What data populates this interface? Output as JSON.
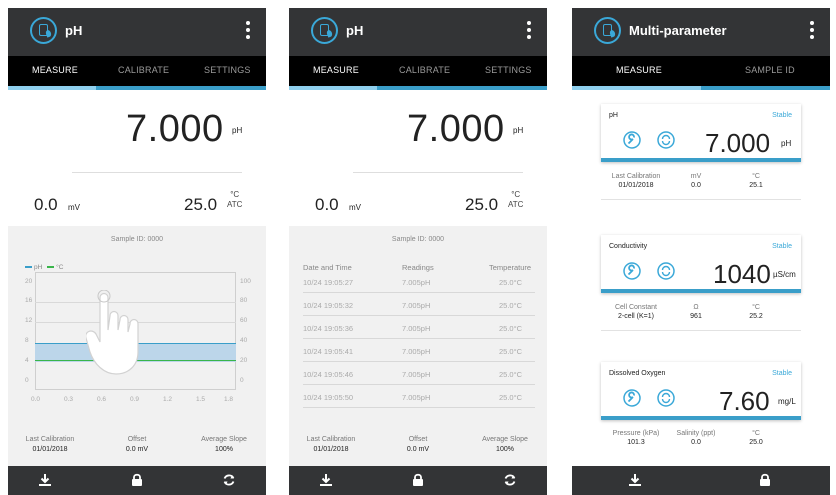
{
  "screens": [
    {
      "app_title": "pH",
      "tabs": [
        "MEASURE",
        "CALIBRATE",
        "SETTINGS"
      ],
      "main_value": "7.000",
      "main_unit": "pH",
      "mv_value": "0.0",
      "mv_unit": "mV",
      "temp_value": "25.0",
      "temp_unit_top": "°C",
      "temp_unit_bottom": "ATC",
      "sample_id": "Sample ID: 0000",
      "legend": [
        "pH",
        "°C"
      ],
      "left_ticks": [
        "20",
        "16",
        "12",
        "8",
        "4",
        "0"
      ],
      "right_ticks": [
        "100",
        "80",
        "60",
        "40",
        "20",
        "0"
      ],
      "x_ticks": [
        "0.0",
        "0.3",
        "0.6",
        "0.9",
        "1.2",
        "1.5",
        "1.8"
      ],
      "footer": [
        {
          "label": "Last Calibration",
          "value": "01/01/2018"
        },
        {
          "label": "Offset",
          "value": "0.0 mV"
        },
        {
          "label": "Average Slope",
          "value": "100%"
        }
      ]
    },
    {
      "app_title": "pH",
      "tabs": [
        "MEASURE",
        "CALIBRATE",
        "SETTINGS"
      ],
      "main_value": "7.000",
      "main_unit": "pH",
      "mv_value": "0.0",
      "mv_unit": "mV",
      "temp_value": "25.0",
      "temp_unit_top": "°C",
      "temp_unit_bottom": "ATC",
      "sample_id": "Sample ID: 0000",
      "table_headers": [
        "Date and Time",
        "Readings",
        "Temperature"
      ],
      "table_rows": [
        [
          "10/24 19:05:27",
          "7.005pH",
          "25.0°C"
        ],
        [
          "10/24 19:05:32",
          "7.005pH",
          "25.0°C"
        ],
        [
          "10/24 19:05:36",
          "7.005pH",
          "25.0°C"
        ],
        [
          "10/24 19:05:41",
          "7.005pH",
          "25.0°C"
        ],
        [
          "10/24 19:05:46",
          "7.005pH",
          "25.0°C"
        ],
        [
          "10/24 19:05:50",
          "7.005pH",
          "25.0°C"
        ]
      ],
      "footer": [
        {
          "label": "Last Calibration",
          "value": "01/01/2018"
        },
        {
          "label": "Offset",
          "value": "0.0 mV"
        },
        {
          "label": "Average Slope",
          "value": "100%"
        }
      ]
    },
    {
      "app_title": "Multi-parameter",
      "tabs": [
        "MEASURE",
        "SAMPLE ID"
      ],
      "cards": [
        {
          "title": "pH",
          "status": "Stable",
          "value": "7.000",
          "unit": "pH",
          "sub": [
            {
              "label": "Last Calibration",
              "value": "01/01/2018"
            },
            {
              "label": "mV",
              "value": "0.0"
            },
            {
              "label": "°C",
              "value": "25.1"
            }
          ]
        },
        {
          "title": "Conductivity",
          "status": "Stable",
          "value": "1040",
          "unit": "µS/cm",
          "sub": [
            {
              "label": "Cell Constant",
              "value": "2-cell (K=1)"
            },
            {
              "label": "Ω",
              "value": "961"
            },
            {
              "label": "°C",
              "value": "25.2"
            }
          ]
        },
        {
          "title": "Dissolved Oxygen",
          "status": "Stable",
          "value": "7.60",
          "unit": "mg/L",
          "sub": [
            {
              "label": "Pressure (kPa)",
              "value": "101.3"
            },
            {
              "label": "Salinity (ppt)",
              "value": "0.0"
            },
            {
              "label": "°C",
              "value": "25.0"
            }
          ]
        }
      ]
    }
  ],
  "icons": {
    "app": "water-drop-meter-icon",
    "menu": "kebab-menu-icon",
    "download": "download-icon",
    "lock": "lock-icon",
    "refresh": "refresh-icon",
    "calibrate": "wrench-icon",
    "sync": "sync-icon"
  },
  "colors": {
    "accent": "#3a9ec9",
    "accent_light": "#8fd0ee",
    "green": "#39b54a",
    "bar": "#333436",
    "tab_bg": "#000000"
  }
}
